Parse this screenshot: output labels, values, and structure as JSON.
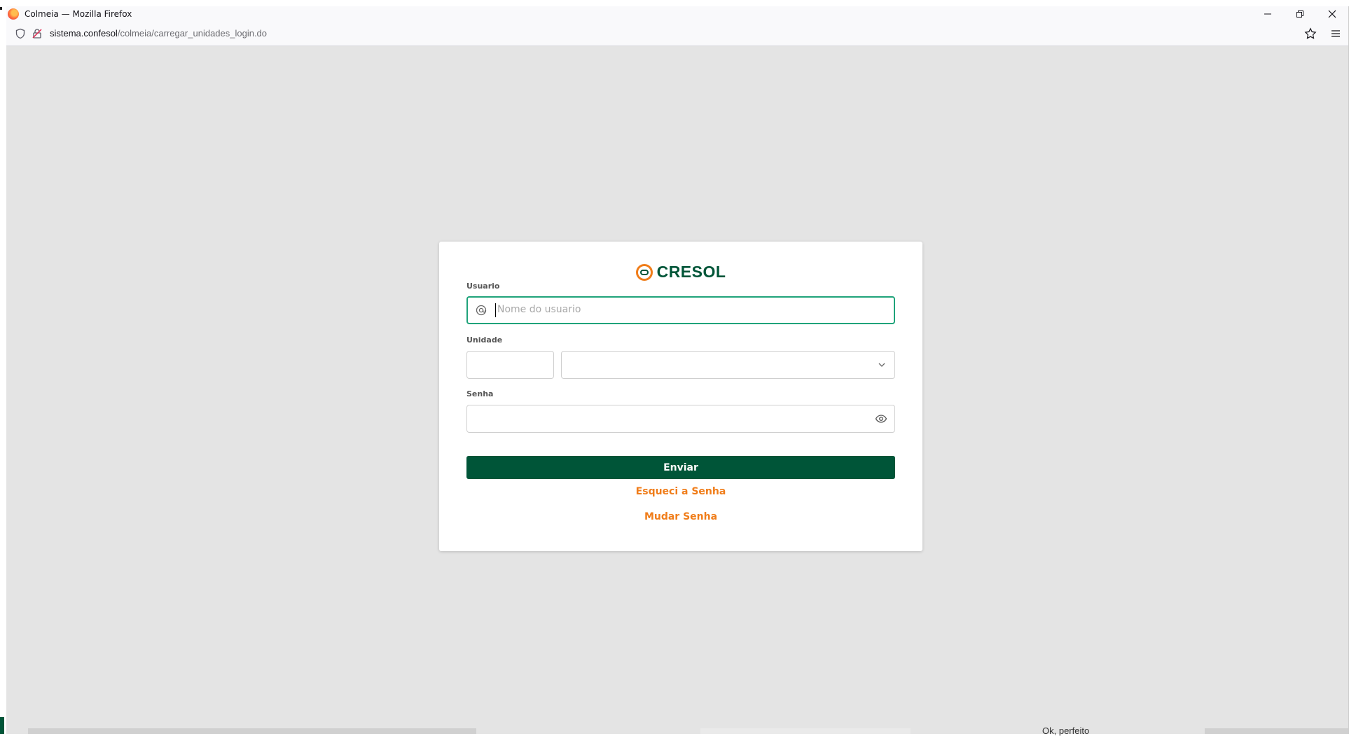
{
  "window": {
    "title": "Colmeia — Mozilla Firefox",
    "controls": {
      "minimize": "–",
      "restore": "⧉",
      "close": "✕"
    }
  },
  "urlbar": {
    "domain": "sistema.confesol",
    "path": "/colmeia/carregar_unidades_login.do"
  },
  "login": {
    "brand": "CRESOL",
    "usuario": {
      "label": "Usuario",
      "placeholder": "Nome do usuario",
      "value": ""
    },
    "unidade": {
      "label": "Unidade",
      "code_value": "",
      "selected": ""
    },
    "senha": {
      "label": "Senha",
      "value": ""
    },
    "submit_label": "Enviar",
    "forgot_link": "Esqueci a Senha",
    "change_link": "Mudar Senha"
  },
  "taskbar": {
    "snippet": "Ok, perfeito"
  },
  "colors": {
    "brand_green": "#005538",
    "accent_orange": "#f07d1a",
    "focus_green": "#1fa37a",
    "background": "#e4e4e4"
  }
}
